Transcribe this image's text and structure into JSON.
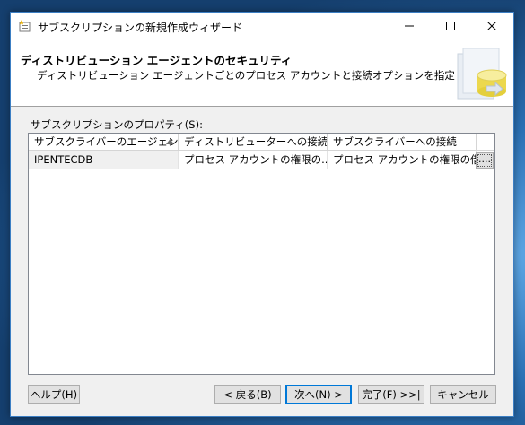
{
  "window": {
    "title": "サブスクリプションの新規作成ウィザード"
  },
  "header": {
    "title": "ディストリビューション エージェントのセキュリティ",
    "subtitle": "ディストリビューション エージェントごとのプロセス アカウントと接続オプションを指定します。"
  },
  "properties": {
    "label": "サブスクリプションのプロパティ(S):",
    "columns": [
      "サブスクライバーのエージェント",
      "ディストリビューターへの接続",
      "サブスクライバーへの接続"
    ],
    "rows": [
      {
        "agent": "IPENTECDB",
        "distributor_connection": "プロセス アカウントの権限の...",
        "subscriber_connection": "プロセス アカウントの権限の借用",
        "edit_label": "...."
      }
    ]
  },
  "buttons": {
    "help": "ヘルプ(H)",
    "back": "< 戻る(B)",
    "next": "次へ(N) >",
    "finish": "完了(F) >>|",
    "cancel": "キャンセル"
  },
  "colors": {
    "accent": "#0078d7",
    "desktop": "#1c5a93"
  }
}
